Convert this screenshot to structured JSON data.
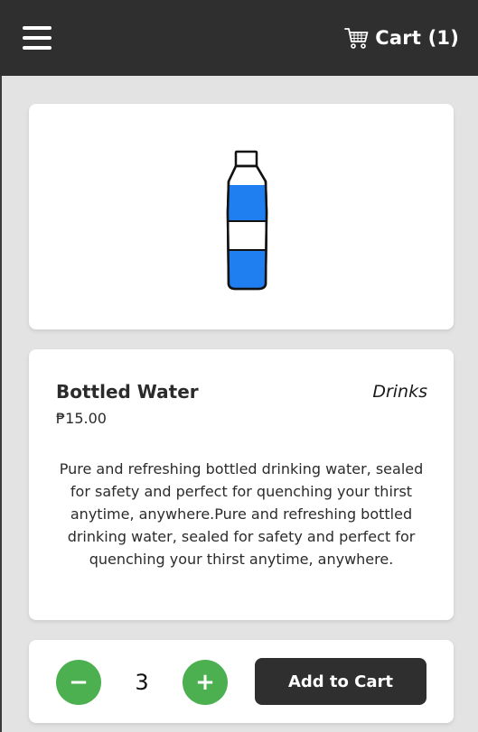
{
  "header": {
    "menu_icon": "hamburger-menu-icon",
    "cart_icon": "shopping-cart-icon",
    "cart_label": "Cart",
    "cart_count": "(1)"
  },
  "product": {
    "image_icon": "water-bottle-illustration",
    "name": "Bottled Water",
    "category": "Drinks",
    "price": "₱15.00",
    "description": "Pure and refreshing bottled drinking water, sealed for safety and perfect for quenching your thirst anytime, anywhere.Pure and refreshing bottled drinking water, sealed for safety and perfect for quenching your thirst anytime, anywhere."
  },
  "actions": {
    "minus_label": "−",
    "quantity": "3",
    "plus_label": "+",
    "add_to_cart_label": "Add to Cart"
  },
  "colors": {
    "header_bg": "#2f2f2f",
    "page_bg": "#e3e3e3",
    "qty_button": "#4caf50",
    "bottle_blue": "#1f7ef0",
    "add_button": "#2f2f2f"
  }
}
